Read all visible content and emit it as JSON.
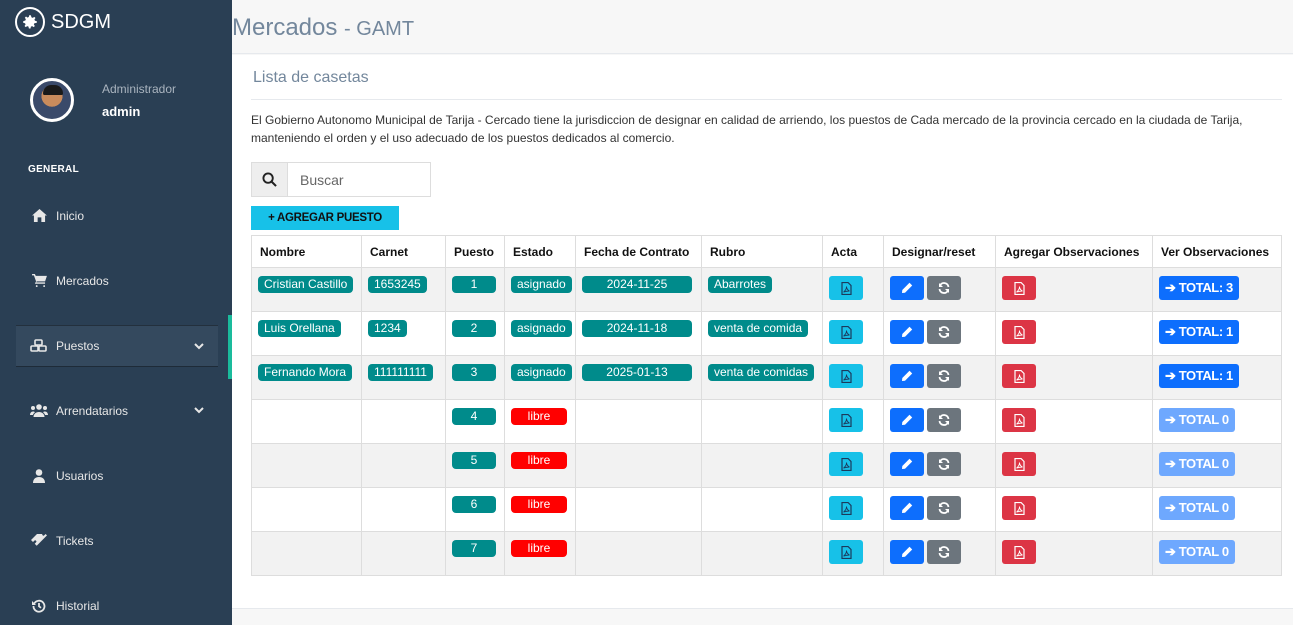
{
  "brand": {
    "name": "SDGM",
    "icon": "gear-icon"
  },
  "profile": {
    "role": "Administrador",
    "name": "admin"
  },
  "sidebar": {
    "section": "GENERAL",
    "items": [
      {
        "label": "Inicio",
        "icon": "home-icon"
      },
      {
        "label": "Mercados",
        "icon": "cart-icon"
      },
      {
        "label": "Puestos",
        "icon": "cubes-icon"
      },
      {
        "label": "Arrendatarios",
        "icon": "users-icon"
      },
      {
        "label": "Usuarios",
        "icon": "user-icon"
      },
      {
        "label": "Tickets",
        "icon": "ticket-icon"
      },
      {
        "label": "Historial",
        "icon": "history-icon"
      }
    ]
  },
  "header": {
    "title": "Mercados",
    "subtitle": "- GAMT"
  },
  "panel": {
    "title": "Lista de casetas",
    "description": "El Gobierno Autonomo Municipal de Tarija - Cercado tiene la jurisdiccion de designar en calidad de arriendo, los puestos de Cada mercado de la provincia cercado en la ciudada de Tarija, manteniendo el orden y el uso adecuado de los puestos dedicados al comercio."
  },
  "search": {
    "placeholder": "Buscar",
    "value": ""
  },
  "toolbar": {
    "add_label": "+ AGREGAR PUESTO"
  },
  "table": {
    "headers": [
      "Nombre",
      "Carnet",
      "Puesto",
      "Estado",
      "Fecha de Contrato",
      "Rubro",
      "Acta",
      "Designar/reset",
      "Agregar Observaciones",
      "Ver Observaciones"
    ],
    "rows": [
      {
        "nombre": "Cristian Castillo",
        "carnet": "1653245",
        "puesto": "1",
        "estado": "asignado",
        "fecha": "2024-11-25",
        "rubro": "Abarrotes",
        "total": "TOTAL: 3"
      },
      {
        "nombre": "Luis Orellana",
        "carnet": "1234",
        "puesto": "2",
        "estado": "asignado",
        "fecha": "2024-11-18",
        "rubro": "venta de comida",
        "total": "TOTAL: 1"
      },
      {
        "nombre": "Fernando Mora",
        "carnet": "111111111",
        "puesto": "3",
        "estado": "asignado",
        "fecha": "2025-01-13",
        "rubro": "venta de comidas",
        "total": "TOTAL: 1"
      },
      {
        "nombre": "",
        "carnet": "",
        "puesto": "4",
        "estado": "libre",
        "fecha": "",
        "rubro": "",
        "total": "TOTAL 0"
      },
      {
        "nombre": "",
        "carnet": "",
        "puesto": "5",
        "estado": "libre",
        "fecha": "",
        "rubro": "",
        "total": "TOTAL 0"
      },
      {
        "nombre": "",
        "carnet": "",
        "puesto": "6",
        "estado": "libre",
        "fecha": "",
        "rubro": "",
        "total": "TOTAL 0"
      },
      {
        "nombre": "",
        "carnet": "",
        "puesto": "7",
        "estado": "libre",
        "fecha": "",
        "rubro": "",
        "total": "TOTAL 0"
      }
    ]
  },
  "colors": {
    "sidebar": "#2a3f54",
    "accent": "#1abb9c",
    "teal": "#008b8b",
    "libre": "#ff0000",
    "primary": "#0d6efd"
  }
}
